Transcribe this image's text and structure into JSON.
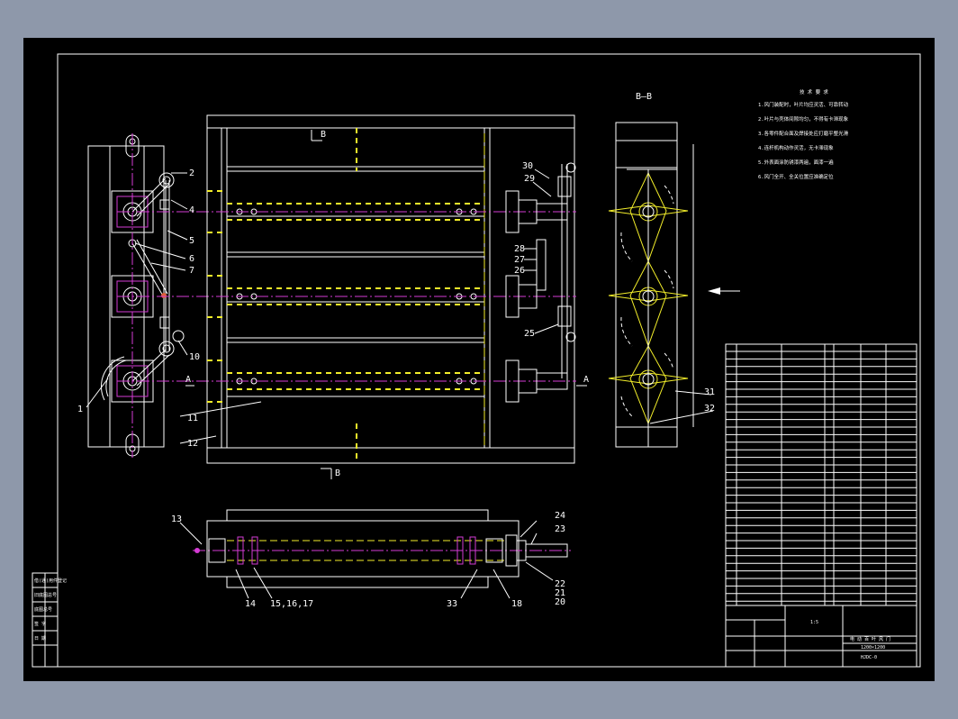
{
  "section_title": "B–B",
  "section_marks": {
    "a_left": "A",
    "a_right": "A",
    "b_top": "B",
    "b_bottom": "B"
  },
  "part_numbers": {
    "left_view": [
      "1",
      "2",
      "4",
      "5",
      "6",
      "7",
      "10",
      "11",
      "12"
    ],
    "right_view": [
      "30",
      "29",
      "28",
      "27",
      "26",
      "25"
    ],
    "section_view": [
      "31",
      "32"
    ],
    "bottom_view_left": [
      "13",
      "14",
      "15,16,17"
    ],
    "bottom_view_right": [
      "24",
      "23",
      "33",
      "18",
      "22",
      "21",
      "20"
    ]
  },
  "tech_notes_title": "技 术 要 求",
  "tech_notes": [
    "1.风门装配时，叶片均应灵活、可靠转动",
    "2.叶片与壳体间隙均匀，不得有卡滞现象",
    "3.各零件配合面及焊接处应打磨平整光滑",
    "4.连杆机构动作灵活，无卡滞现象",
    "5.外表面涂防锈漆两遍，面漆一遍",
    "6.风门全开、全关位置应准确定位"
  ],
  "title_block": {
    "drawing_title": "电 动 百 叶 风 门",
    "size": "1200×1200",
    "drawing_no": "HJDC-0",
    "scale": "1:5"
  },
  "left_strip_labels": [
    "借(通)用件登记",
    "旧底图总号",
    "底图总号",
    "签 字",
    "日 期"
  ],
  "colors": {
    "background_outer": "#8e98aa",
    "paper": "#000000",
    "line": "#ffffff",
    "highlight": "#f3ee2a",
    "center_line": "#d53bd5"
  }
}
